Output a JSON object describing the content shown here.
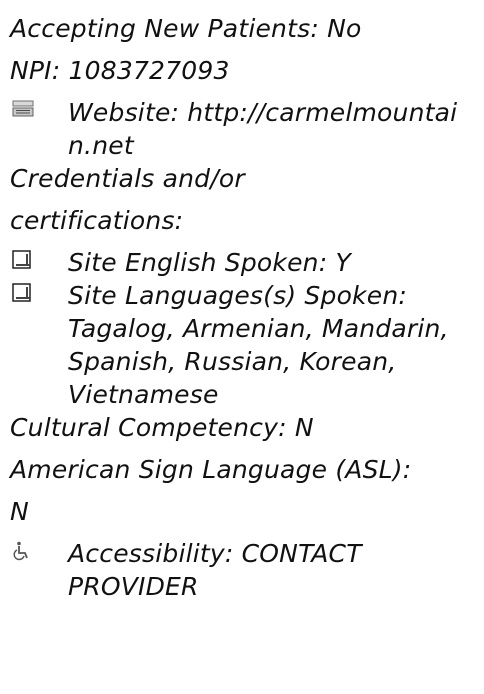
{
  "details": {
    "accepting": "Accepting New Patients: No",
    "npi": "NPI: 1083727093",
    "website": "Website: http://carmelmountain.net",
    "credentials_1": "Credentials and/or",
    "credentials_2": "certifications:",
    "english": "Site English Spoken: Y",
    "languages": "Site Languages(s) Spoken: Tagalog, Armenian, Mandarin, Spanish, Russian, Korean, Vietnamese",
    "cultural": "Cultural Competency: N",
    "asl_1": "American Sign Language (ASL):",
    "asl_2": "N",
    "accessibility": "Accessibility: CONTACT PROVIDER"
  },
  "icons": {
    "website": "keyboard-icon",
    "english": "checkbox-icon",
    "languages": "checkbox-icon",
    "accessibility": "wheelchair-icon"
  }
}
